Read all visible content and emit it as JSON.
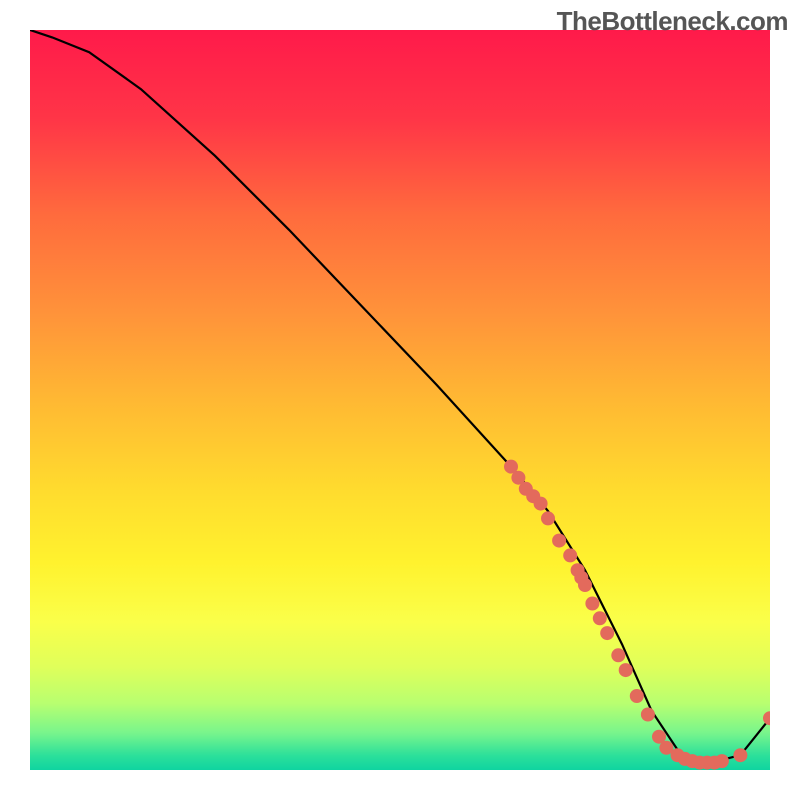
{
  "watermark": "TheBottleneck.com",
  "chart_data": {
    "type": "line",
    "title": "",
    "xlabel": "",
    "ylabel": "",
    "xlim": [
      0,
      100
    ],
    "ylim": [
      0,
      100
    ],
    "grid": false,
    "background": "heatmap-red-yellow-green",
    "series": [
      {
        "name": "bottleneck-curve",
        "color": "#000000",
        "x": [
          0,
          3,
          8,
          15,
          25,
          35,
          45,
          55,
          65,
          70,
          75,
          80,
          84,
          88,
          92,
          96,
          100
        ],
        "y": [
          100,
          99,
          97,
          92,
          83,
          73,
          62.5,
          52,
          41,
          35,
          27,
          17,
          8,
          2,
          1,
          2,
          7
        ]
      }
    ],
    "scatter_points": {
      "name": "hardware-points",
      "color": "#e36a5c",
      "radius": 7,
      "points": [
        {
          "x": 65,
          "y": 41
        },
        {
          "x": 66,
          "y": 39.5
        },
        {
          "x": 67,
          "y": 38
        },
        {
          "x": 68,
          "y": 37
        },
        {
          "x": 69,
          "y": 36
        },
        {
          "x": 70,
          "y": 34
        },
        {
          "x": 71.5,
          "y": 31
        },
        {
          "x": 73,
          "y": 29
        },
        {
          "x": 74,
          "y": 27
        },
        {
          "x": 74.5,
          "y": 26
        },
        {
          "x": 75,
          "y": 25
        },
        {
          "x": 76,
          "y": 22.5
        },
        {
          "x": 77,
          "y": 20.5
        },
        {
          "x": 78,
          "y": 18.5
        },
        {
          "x": 79.5,
          "y": 15.5
        },
        {
          "x": 80.5,
          "y": 13.5
        },
        {
          "x": 82,
          "y": 10
        },
        {
          "x": 83.5,
          "y": 7.5
        },
        {
          "x": 85,
          "y": 4.5
        },
        {
          "x": 86,
          "y": 3
        },
        {
          "x": 87.5,
          "y": 2
        },
        {
          "x": 88.5,
          "y": 1.5
        },
        {
          "x": 89.5,
          "y": 1.2
        },
        {
          "x": 90.5,
          "y": 1
        },
        {
          "x": 91.5,
          "y": 1
        },
        {
          "x": 92.5,
          "y": 1
        },
        {
          "x": 93.5,
          "y": 1.2
        },
        {
          "x": 96,
          "y": 2
        },
        {
          "x": 100,
          "y": 7
        }
      ]
    },
    "gradient_stops": [
      {
        "offset": 0,
        "color": "#ff1a4a"
      },
      {
        "offset": 12,
        "color": "#ff3547"
      },
      {
        "offset": 25,
        "color": "#ff6b3d"
      },
      {
        "offset": 38,
        "color": "#ff923a"
      },
      {
        "offset": 50,
        "color": "#ffb833"
      },
      {
        "offset": 62,
        "color": "#ffdb2e"
      },
      {
        "offset": 72,
        "color": "#fff22e"
      },
      {
        "offset": 80,
        "color": "#faff4a"
      },
      {
        "offset": 86,
        "color": "#e0ff5a"
      },
      {
        "offset": 91,
        "color": "#b8ff70"
      },
      {
        "offset": 95,
        "color": "#78f58c"
      },
      {
        "offset": 98,
        "color": "#2de09a"
      },
      {
        "offset": 100,
        "color": "#0fd4a0"
      }
    ]
  }
}
